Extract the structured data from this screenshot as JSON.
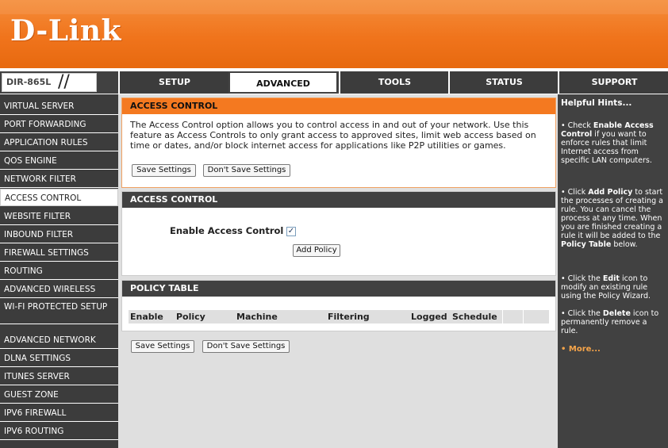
{
  "brand": {
    "logo": "D-Link",
    "model": "DIR-865L",
    "slash": "//"
  },
  "topnav": [
    "SETUP",
    "ADVANCED",
    "TOOLS",
    "STATUS",
    "SUPPORT"
  ],
  "leftnav": [
    "VIRTUAL SERVER",
    "PORT FORWARDING",
    "APPLICATION RULES",
    "QOS ENGINE",
    "NETWORK FILTER",
    "ACCESS CONTROL",
    "WEBSITE FILTER",
    "INBOUND FILTER",
    "FIREWALL SETTINGS",
    "ROUTING",
    "ADVANCED WIRELESS",
    "WI-FI PROTECTED SETUP",
    "ADVANCED NETWORK",
    "DLNA SETTINGS",
    "ITUNES SERVER",
    "GUEST ZONE",
    "IPV6 FIREWALL",
    "IPV6 ROUTING"
  ],
  "section1": {
    "title": "ACCESS CONTROL",
    "description": "The Access Control option allows you to control access in and out of your network. Use this feature as Access Controls to only grant access to approved sites, limit web access based on time or dates, and/or block internet access for applications like P2P utilities or games.",
    "save": "Save Settings",
    "dont_save": "Don't Save Settings"
  },
  "section2": {
    "title": "ACCESS CONTROL",
    "enable_label": "Enable Access Control :",
    "enable_checked": true,
    "add_policy": "Add Policy"
  },
  "section3": {
    "title": "POLICY TABLE",
    "columns": [
      "Enable",
      "Policy",
      "Machine",
      "Filtering",
      "Logged",
      "Schedule"
    ]
  },
  "bottom_buttons": {
    "save": "Save Settings",
    "dont_save": "Don't Save Settings"
  },
  "hints": {
    "title": "Helpful Hints...",
    "items": [
      {
        "pre": "• Check ",
        "bold": "Enable Access Control",
        "post": " if you want to enforce rules that limit Internet access from specific LAN computers."
      },
      {
        "pre": "• Click ",
        "bold": "Add Policy",
        "post": " to start the processes of creating a rule. You can cancel the process at any time. When you are finished creating a rule it will be added to the ",
        "bold2": "Policy Table",
        "post2": " below."
      },
      {
        "pre": "• Click the ",
        "bold": "Edit",
        "post": " icon to modify an existing rule using the Policy Wizard."
      },
      {
        "pre": "• Click the ",
        "bold": "Delete",
        "post": " icon to permanently remove a rule."
      }
    ],
    "more": "• More..."
  },
  "colors": {
    "orange": "#f47920",
    "dark": "#414141",
    "panel": "#dfdfdf"
  }
}
